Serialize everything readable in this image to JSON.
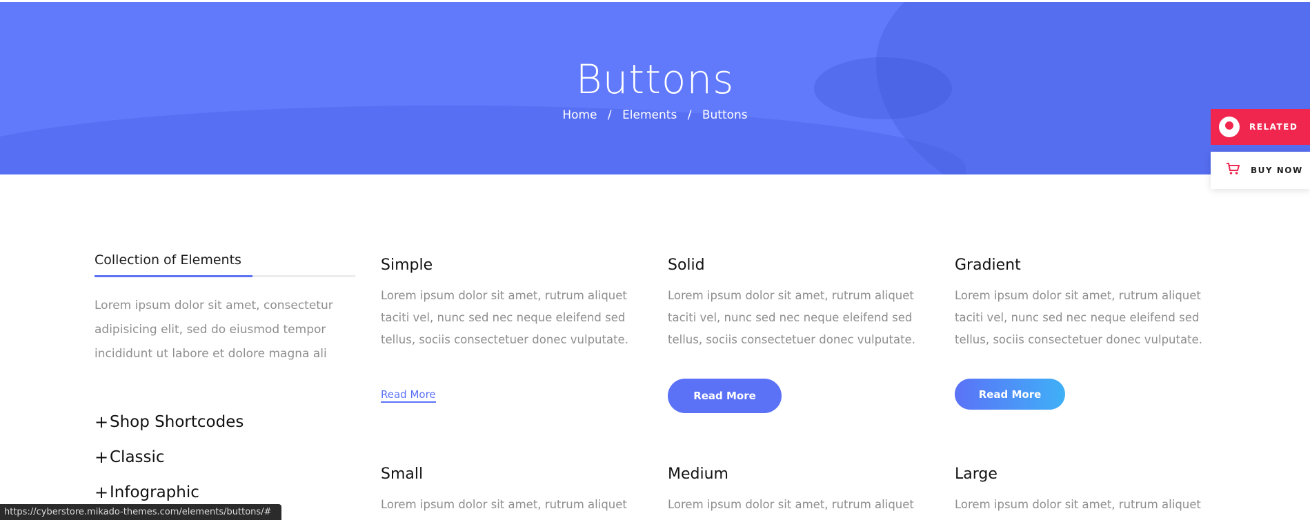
{
  "hero": {
    "title": "Buttons",
    "breadcrumb": [
      "Home",
      "Elements",
      "Buttons"
    ],
    "separator": "/"
  },
  "side_buttons": {
    "related_label": "RELATED",
    "buy_label": "BUY NOW"
  },
  "sidebar": {
    "title": "Collection of Elements",
    "description": "Lorem ipsum dolor sit amet, consectetur adipisicing elit, sed do eiusmod tempor incididunt ut labore et dolore magna ali",
    "items": [
      {
        "label": "Shop Shortcodes"
      },
      {
        "label": "Classic"
      },
      {
        "label": "Infographic"
      }
    ]
  },
  "cards": [
    {
      "title": "Simple",
      "text": "Lorem ipsum dolor sit amet, rutrum aliquet taciti vel, nunc sed nec neque eleifend sed tellus, sociis consectetuer donec vulputate.",
      "button": "Read More"
    },
    {
      "title": "Solid",
      "text": "Lorem ipsum dolor sit amet, rutrum aliquet taciti vel, nunc sed nec neque eleifend sed tellus, sociis consectetuer donec vulputate.",
      "button": "Read More"
    },
    {
      "title": "Gradient",
      "text": "Lorem ipsum dolor sit amet, rutrum aliquet taciti vel, nunc sed nec neque eleifend sed tellus, sociis consectetuer donec vulputate.",
      "button": "Read More"
    },
    {
      "title": "Small",
      "text": "Lorem ipsum dolor sit amet, rutrum aliquet"
    },
    {
      "title": "Medium",
      "text": "Lorem ipsum dolor sit amet, rutrum aliquet"
    },
    {
      "title": "Large",
      "text": "Lorem ipsum dolor sit amet, rutrum aliquet"
    }
  ],
  "status_bar": {
    "url": "https://cyberstore.mikado-themes.com/elements/buttons/#"
  },
  "colors": {
    "hero": "#6179fb",
    "accent": "#5b72f7",
    "related": "#f0264e",
    "gradient_end": "#3fb0f7"
  }
}
